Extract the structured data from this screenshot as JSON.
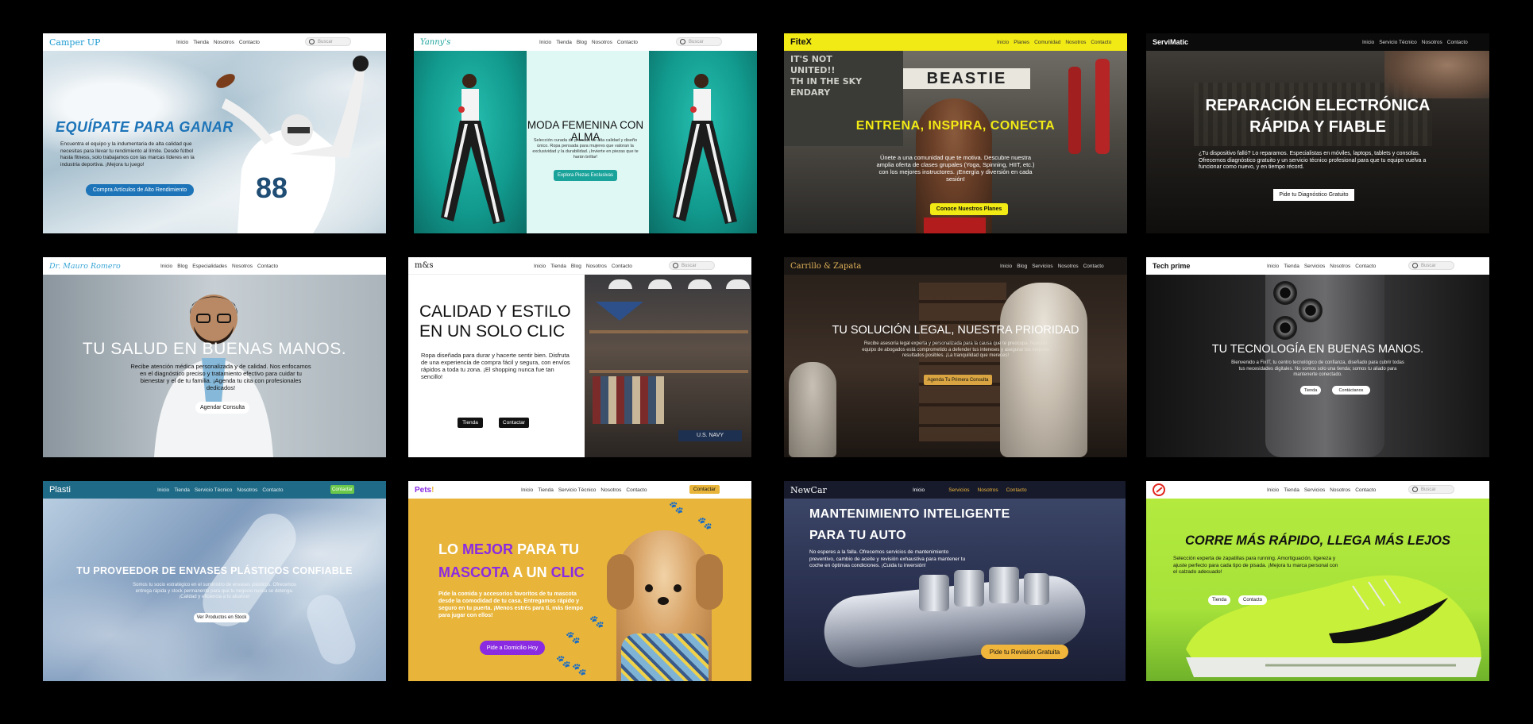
{
  "cards": {
    "camper": {
      "logo": "Camper UP",
      "nav": [
        "Inicio",
        "Tienda",
        "Nosotros",
        "Contacto"
      ],
      "search_placeholder": "Buscar",
      "title": "EQUÍPATE PARA GANAR",
      "text": "Encuentra el equipo y la indumentaria de alta calidad que necesitas para llevar tu rendimiento al límite. Desde fútbol hasta fitness, solo trabajamos con las marcas líderes en la industria deportiva. ¡Mejora tu juego!",
      "cta": "Compra Artículos de Alto Rendimiento",
      "jersey": "88"
    },
    "yanny": {
      "logo": "Yanny's",
      "nav": [
        "Inicio",
        "Tienda",
        "Blog",
        "Nosotros",
        "Contacto"
      ],
      "search_placeholder": "Buscar",
      "title": "MODA FEMENINA CON ALMA",
      "text": "Selección curada de prendas de alta calidad y diseño único. Ropa pensada para mujeres que valoran la exclusividad y la durabilidad. ¡Invierte en piezas que te harán brillar!",
      "cta": "Explora Piezas Exclusivas"
    },
    "fitex": {
      "logo": "FiteX",
      "nav": [
        "Inicio",
        "Planes",
        "Comunidad",
        "Nosotros",
        "Contacto"
      ],
      "title": "ENTRENA, INSPIRA, CONECTA",
      "text": "Únete a una comunidad que te motiva. Descubre nuestra amplia oferta de clases grupales (Yoga, Spinning, HIIT, etc.) con los mejores instructores. ¡Energía y diversión en cada sesión!",
      "cta": "Conoce Nuestros Planes",
      "banner": "BEASTIE",
      "chalk": "IT'S NOT\nUNITED!!\nTH IN THE SKY\nENDARY"
    },
    "servimatic": {
      "logo": "ServiMatic",
      "nav": [
        "Inicio",
        "Servicio Técnico",
        "Nosotros",
        "Contacto"
      ],
      "title": "REPARACIÓN ELECTRÓNICA RÁPIDA Y FIABLE",
      "text": "¿Tu dispositivo falló? Lo reparamos. Especialistas en móviles, laptops, tablets y consolas. Ofrecemos diagnóstico gratuito y un servicio técnico profesional para que tu equipo vuelva a funcionar como nuevo, y en tiempo récord.",
      "cta": "Pide tu Diagnóstico Gratuito"
    },
    "drmauro": {
      "logo": "Dr. Mauro Romero",
      "nav": [
        "Inicio",
        "Blog",
        "Especialidades",
        "Nosotros",
        "Contacto"
      ],
      "title": "TU SALUD EN BUENAS MANOS.",
      "text": "Recibe atención médica personalizada y de calidad. Nos enfocamos en el diagnóstico preciso y tratamiento efectivo para cuidar tu bienestar y el de tu familia. ¡Agenda tu cita con profesionales dedicados!",
      "cta": "Agendar Consulta"
    },
    "mcs": {
      "logo": "m&s",
      "nav": [
        "Inicio",
        "Tienda",
        "Blog",
        "Nosotros",
        "Contacto"
      ],
      "search_placeholder": "Buscar",
      "title": "CALIDAD Y ESTILO EN UN SOLO CLIC",
      "text": "Ropa diseñada para durar y hacerte sentir bien. Disfruta de una experiencia de compra fácil y segura, con envíos rápidos a toda tu zona. ¡El shopping nunca fue tan sencillo!",
      "btn1": "Tienda",
      "btn2": "Contactar",
      "store_sign": "U.S. NAVY"
    },
    "carrillo": {
      "logo": "Carrillo & Zapata",
      "nav": [
        "Inicio",
        "Blog",
        "Servicios",
        "Nosotros",
        "Contacto"
      ],
      "title": "TU SOLUCIÓN LEGAL, NUESTRA PRIORIDAD",
      "text": "Recibe asesoría legal experta y personalizada para la causa que te preocupa. Nuestro equipo de abogados está comprometido a defender tus intereses y asegurar los mejores resultados posibles. ¡La tranquilidad que mereces!",
      "cta": "Agenda Tu Primera Consulta"
    },
    "techprime": {
      "logo": "Tech prime",
      "nav": [
        "Inicio",
        "Tienda",
        "Servicios",
        "Nosotros",
        "Contacto"
      ],
      "search_placeholder": "Buscar",
      "title": "TU TECNOLOGÍA EN BUENAS MANOS.",
      "text": "Bienvenido a FixIT, tu centro tecnológico de confianza, diseñado para cubrir todas tus necesidades digitales. No somos solo una tienda; somos tu aliado para mantenerte conectado.",
      "btn1": "Tienda",
      "btn2": "Contáctanos"
    },
    "plasti": {
      "logo": "Plasti",
      "nav": [
        "Inicio",
        "Tienda",
        "Servicio Técnico",
        "Nosotros",
        "Contacto"
      ],
      "nav_cta": "Contactar",
      "title": "TU PROVEEDOR DE ENVASES PLÁSTICOS CONFIABLE",
      "text": "Somos tu socio estratégico en el suministro de envases plásticos. Ofrecemos entrega rápida y stock permanente para que tu negocio nunca se detenga. ¡Calidad y eficiencia a tu alcance!",
      "cta": "Ver Productos en Stock"
    },
    "pets": {
      "logo": "Pets",
      "logo_mark": "!",
      "nav": [
        "Inicio",
        "Tienda",
        "Servicio Técnico",
        "Nosotros",
        "Contacto"
      ],
      "nav_cta": "Contactar",
      "title_l1a": "LO ",
      "title_l1b": "MEJOR",
      "title_l1c": " PARA TU",
      "title_l2a": "MASCOTA",
      "title_l2b": " A UN ",
      "title_l2c": "CLIC",
      "text": "Pide la comida y accesorios favoritos de tu mascota desde la comodidad de tu casa. Entregamos rápido y seguro en tu puerta. ¡Menos estrés para ti, más tiempo para jugar con ellos!",
      "cta": "Pide a Domicilio Hoy"
    },
    "newcar": {
      "logo": "NewCar",
      "nav": [
        "Inicio",
        "Servicios",
        "Nosotros",
        "Contacto"
      ],
      "title": "MANTENIMIENTO INTELIGENTE PARA TU AUTO",
      "text": "No esperes a la falla. Ofrecemos servicios de mantenimiento preventivo, cambio de aceite y revisión exhaustiva para mantener tu coche en óptimas condiciones. ¡Cuida tu inversión!",
      "cta": "Pide tu Revisión Gratuita"
    },
    "running": {
      "nav": [
        "Inicio",
        "Tienda",
        "Servicios",
        "Nosotros",
        "Contacto"
      ],
      "search_placeholder": "Buscar",
      "title": "CORRE MÁS RÁPIDO, LLEGA MÁS LEJOS",
      "text": "Selección experta de zapatillas para running. Amortiguación, ligereza y ajuste perfecto para cada tipo de pisada. ¡Mejora tu marca personal con el calzado adecuado!",
      "btn1": "Tienda",
      "btn2": "Contacto"
    }
  },
  "colors": {
    "camper_blue": "#1d74b8",
    "yanny_teal": "#1aa39a",
    "fitex_yellow": "#f2ea14",
    "pets_yellow": "#e8b53a",
    "pets_purple": "#8a2be2",
    "running_green": "#a6e23a",
    "newcar_orange": "#f0b63c",
    "plasti_blue": "#1f6a86"
  }
}
